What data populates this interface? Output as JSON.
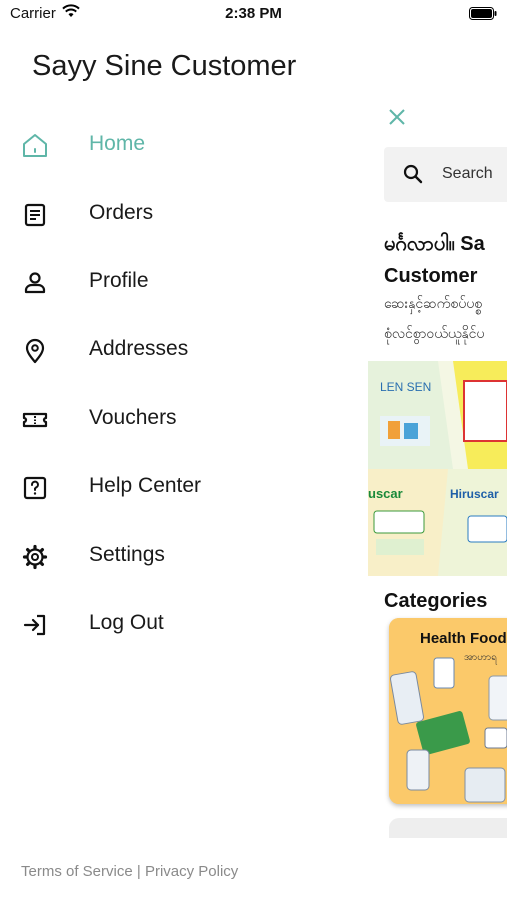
{
  "status_bar": {
    "carrier": "Carrier",
    "time": "2:38 PM"
  },
  "drawer": {
    "title": "Sayy Sine Customer",
    "accent_color": "#5fb6a8",
    "items": [
      {
        "label": "Home",
        "icon": "home-icon",
        "active": true
      },
      {
        "label": "Orders",
        "icon": "orders-icon"
      },
      {
        "label": "Profile",
        "icon": "profile-icon"
      },
      {
        "label": "Addresses",
        "icon": "location-pin-icon"
      },
      {
        "label": "Vouchers",
        "icon": "ticket-icon"
      },
      {
        "label": "Help Center",
        "icon": "help-icon"
      },
      {
        "label": "Settings",
        "icon": "gear-icon"
      },
      {
        "label": "Log Out",
        "icon": "logout-icon"
      }
    ],
    "footer": {
      "terms": "Terms of Service",
      "separator": " | ",
      "privacy": "Privacy Policy"
    }
  },
  "main": {
    "search_placeholder": "Search",
    "welcome": "မင်္ဂလာပါ။ Sa",
    "customer": "Customer",
    "description_line1": "ဆေးနှင့်ဆက်စပ်ပစ္စ",
    "description_line2": "စုံလင်စွာဝယ်ယူနိုင်ပ",
    "banner": {
      "brand1": "LEN SEN",
      "brand2": "Hiruscar",
      "brand3": "uscar"
    },
    "categories_title": "Categories",
    "category_card": {
      "label": "Health Food",
      "sublabel": "အာဟာရ"
    }
  }
}
